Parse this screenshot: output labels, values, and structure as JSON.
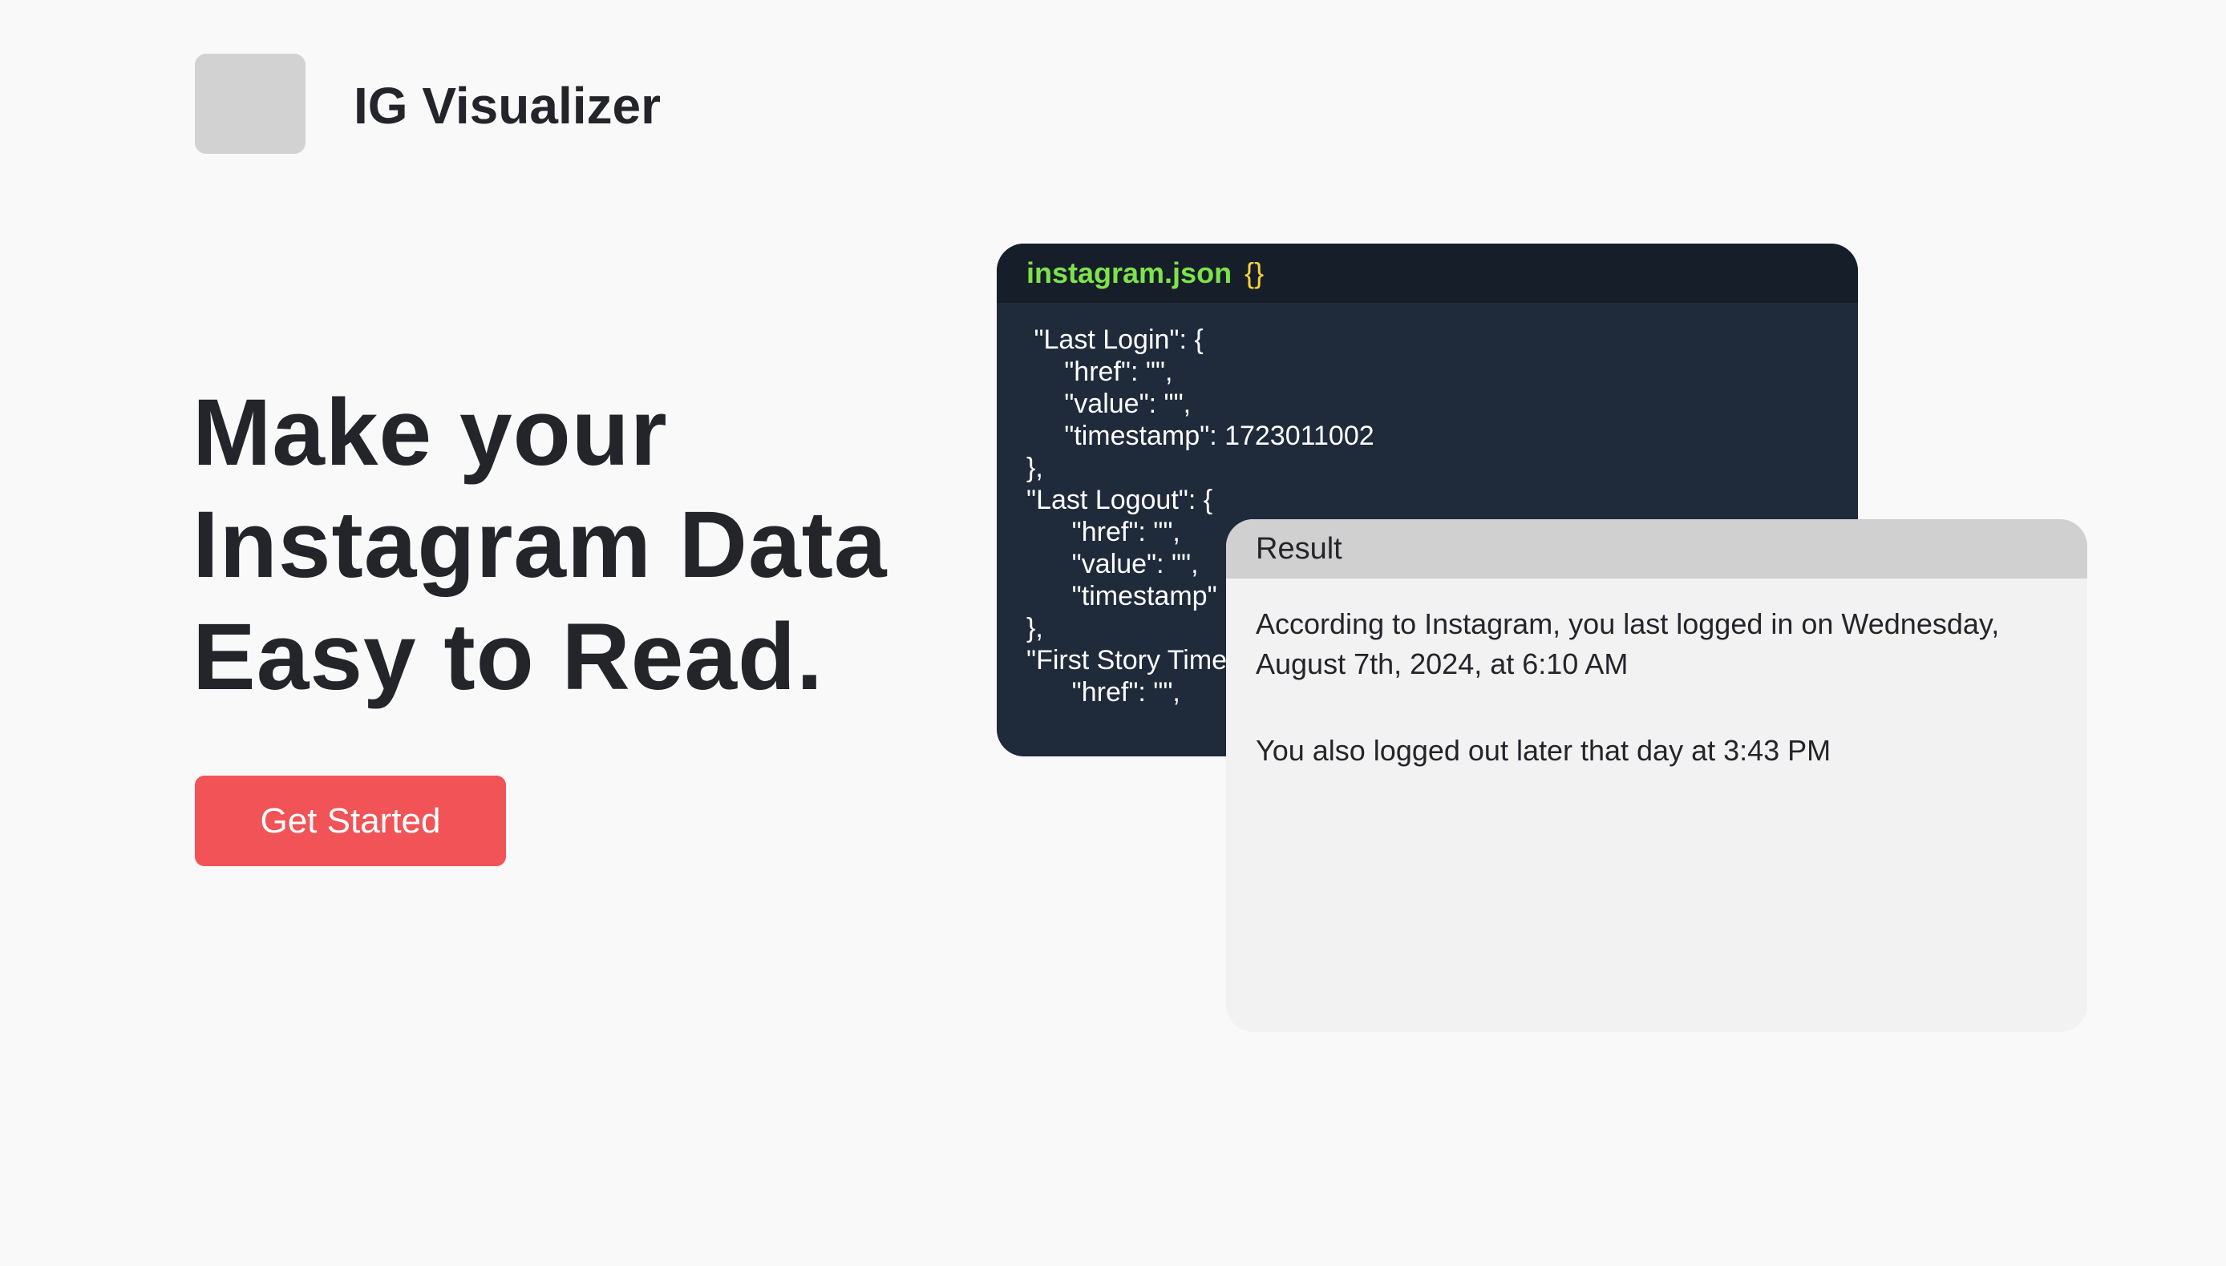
{
  "header": {
    "app_title": "IG Visualizer"
  },
  "hero": {
    "title_lines": [
      "Make your",
      "Instagram Data",
      "Easy to Read."
    ],
    "cta_label": "Get Started"
  },
  "code_panel": {
    "filename": "instagram.json",
    "braces": "{}",
    "lines": [
      " \"Last Login\": {",
      "     \"href\": \"\",",
      "     \"value\": \"\",",
      "     \"timestamp\": 1723011002",
      "},",
      "\"Last Logout\": {",
      "      \"href\": \"\",",
      "      \"value\": \"\",",
      "      \"timestamp\"",
      "},",
      "\"First Story Time",
      "      \"href\": \"\","
    ]
  },
  "result_panel": {
    "title": "Result",
    "paragraphs": [
      "According to Instagram, you last logged in on Wednesday, August 7th, 2024, at 6:10 AM",
      "You also logged out later that day at 3:43 PM"
    ]
  },
  "colors": {
    "background": "#f9f9f9",
    "accent": "#f15356",
    "code_bg": "#1f2a3b",
    "code_header_bg": "#161e2a",
    "filename_green": "#7ee34a",
    "braces_yellow": "#f5d33a",
    "result_bg": "#f2f2f2",
    "result_header_bg": "#d0d0d0"
  }
}
